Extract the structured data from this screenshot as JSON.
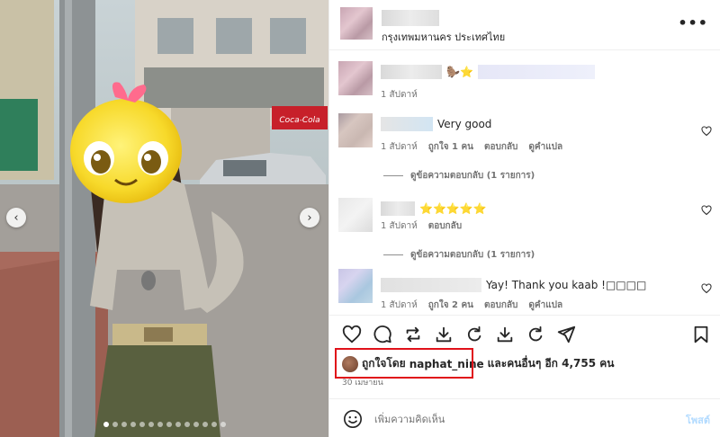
{
  "post": {
    "location": "กรุงเทพมหานคร ประเทศไทย",
    "more_icon": "more-horizontal-icon"
  },
  "photo": {
    "sign_text": "Coca-Cola",
    "carousel_dots": 14,
    "active_dot": 0
  },
  "comments": [
    {
      "text": "",
      "emoji": "🦫⭐",
      "meta": [
        "1 สัปดาห์"
      ],
      "replies": ""
    },
    {
      "text": "Very good",
      "emoji": "",
      "meta": [
        "1 สัปดาห์",
        "ถูกใจ 1 คน",
        "ตอบกลับ",
        "ดูคำแปล"
      ],
      "replies": "ดูข้อความตอบกลับ (1 รายการ)"
    },
    {
      "text": "",
      "emoji": "⭐⭐⭐⭐⭐",
      "meta": [
        "1 สัปดาห์",
        "ตอบกลับ"
      ],
      "replies": "ดูข้อความตอบกลับ (1 รายการ)"
    },
    {
      "text": "Yay! Thank you kaab !□□□□",
      "emoji": "",
      "meta": [
        "1 สัปดาห์",
        "ถูกใจ 2 คน",
        "ตอบกลับ",
        "ดูคำแปล"
      ],
      "replies": ""
    }
  ],
  "likes": {
    "prefix": "ถูกใจโดย",
    "user": "naphat_nine",
    "suffix": "และคนอื่นๆ อีก 4,755 คน"
  },
  "date": "30 เมษายน",
  "compose": {
    "placeholder": "เพิ่มความคิดเห็น",
    "post_label": "โพสต์",
    "post_color": "#b3dbff"
  },
  "colors": {
    "highlight_box": "#e0121a",
    "meta_text": "#737373"
  }
}
